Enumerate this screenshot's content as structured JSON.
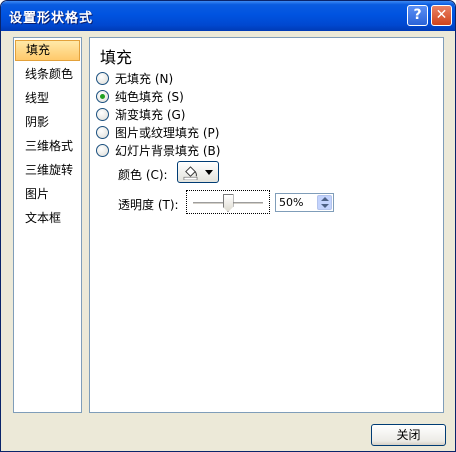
{
  "window": {
    "title": "设置形状格式",
    "help_label": "?",
    "close_label": "✕"
  },
  "sidebar": {
    "items": [
      {
        "label": "填充",
        "selected": true
      },
      {
        "label": "线条颜色",
        "selected": false
      },
      {
        "label": "线型",
        "selected": false
      },
      {
        "label": "阴影",
        "selected": false
      },
      {
        "label": "三维格式",
        "selected": false
      },
      {
        "label": "三维旋转",
        "selected": false
      },
      {
        "label": "图片",
        "selected": false
      },
      {
        "label": "文本框",
        "selected": false
      }
    ]
  },
  "panel": {
    "heading": "填充",
    "fill_options": [
      {
        "label": "无填充 (N)",
        "checked": false
      },
      {
        "label": "纯色填充 (S)",
        "checked": true
      },
      {
        "label": "渐变填充 (G)",
        "checked": false
      },
      {
        "label": "图片或纹理填充 (P)",
        "checked": false
      },
      {
        "label": "幻灯片背景填充 (B)",
        "checked": false
      }
    ],
    "color_label": "颜色 (C):",
    "color_icon": "fill-bucket-icon",
    "transparency_label": "透明度 (T):",
    "transparency_value": "50%",
    "transparency_fraction": 0.5
  },
  "footer": {
    "close_button": "关闭"
  },
  "colors": {
    "titlebar": "#0053e0",
    "selected_item": "#ffc96b",
    "radio_dot": "#21a121"
  }
}
